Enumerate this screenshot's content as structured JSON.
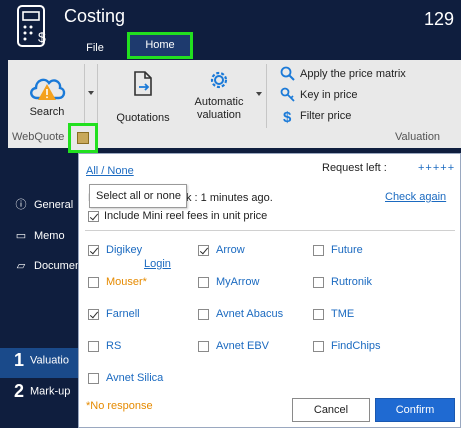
{
  "app": {
    "title": "Costing",
    "counter": "129"
  },
  "menu": {
    "file": "File",
    "home": "Home"
  },
  "ribbon": {
    "search_label": "Search",
    "quotations_label": "Quotations",
    "automatic_label_1": "Automatic",
    "automatic_label_2": "valuation",
    "webquote_group": "WebQuote",
    "valuation_group": "Valuation",
    "apply_matrix": "Apply the price matrix",
    "key_in_price": "Key in price",
    "filter_price": "Filter price"
  },
  "sidebar": {
    "general": "General",
    "memo": "Memo",
    "documents": "Documen",
    "valuation_num": "1",
    "valuation": "Valuatio",
    "markup_num": "2",
    "markup": "Mark-up"
  },
  "popup": {
    "all_none": "All / None",
    "request_left_label": "Request left :",
    "request_left_value": "+++++",
    "status_prefix": "L",
    "status_text": "k : 1 minutes ago.",
    "check_again": "Check again",
    "tooltip": "Select all or none",
    "include_mini_reel": "Include Mini reel fees in unit price",
    "include_mini_reel_checked": true,
    "login": "Login",
    "no_response": "*No response",
    "cancel": "Cancel",
    "confirm": "Confirm",
    "suppliers": [
      {
        "name": "Digikey",
        "checked": true,
        "color": "#1b6ac0"
      },
      {
        "name": "Arrow",
        "checked": true,
        "color": "#1b6ac0"
      },
      {
        "name": "Future",
        "checked": false,
        "color": "#1b6ac0"
      },
      {
        "name": "Mouser*",
        "checked": false,
        "color": "#e58a00"
      },
      {
        "name": "MyArrow",
        "checked": false,
        "color": "#1b6ac0"
      },
      {
        "name": "Rutronik",
        "checked": false,
        "color": "#1b6ac0"
      },
      {
        "name": "Farnell",
        "checked": true,
        "color": "#1b6ac0"
      },
      {
        "name": "Avnet Abacus",
        "checked": false,
        "color": "#1b6ac0"
      },
      {
        "name": "TME",
        "checked": false,
        "color": "#1b6ac0"
      },
      {
        "name": "RS",
        "checked": false,
        "color": "#1b6ac0"
      },
      {
        "name": "Avnet EBV",
        "checked": false,
        "color": "#1b6ac0"
      },
      {
        "name": "FindChips",
        "checked": false,
        "color": "#1b6ac0"
      },
      {
        "name": "Avnet Silica",
        "checked": false,
        "color": "#1b6ac0"
      }
    ]
  }
}
